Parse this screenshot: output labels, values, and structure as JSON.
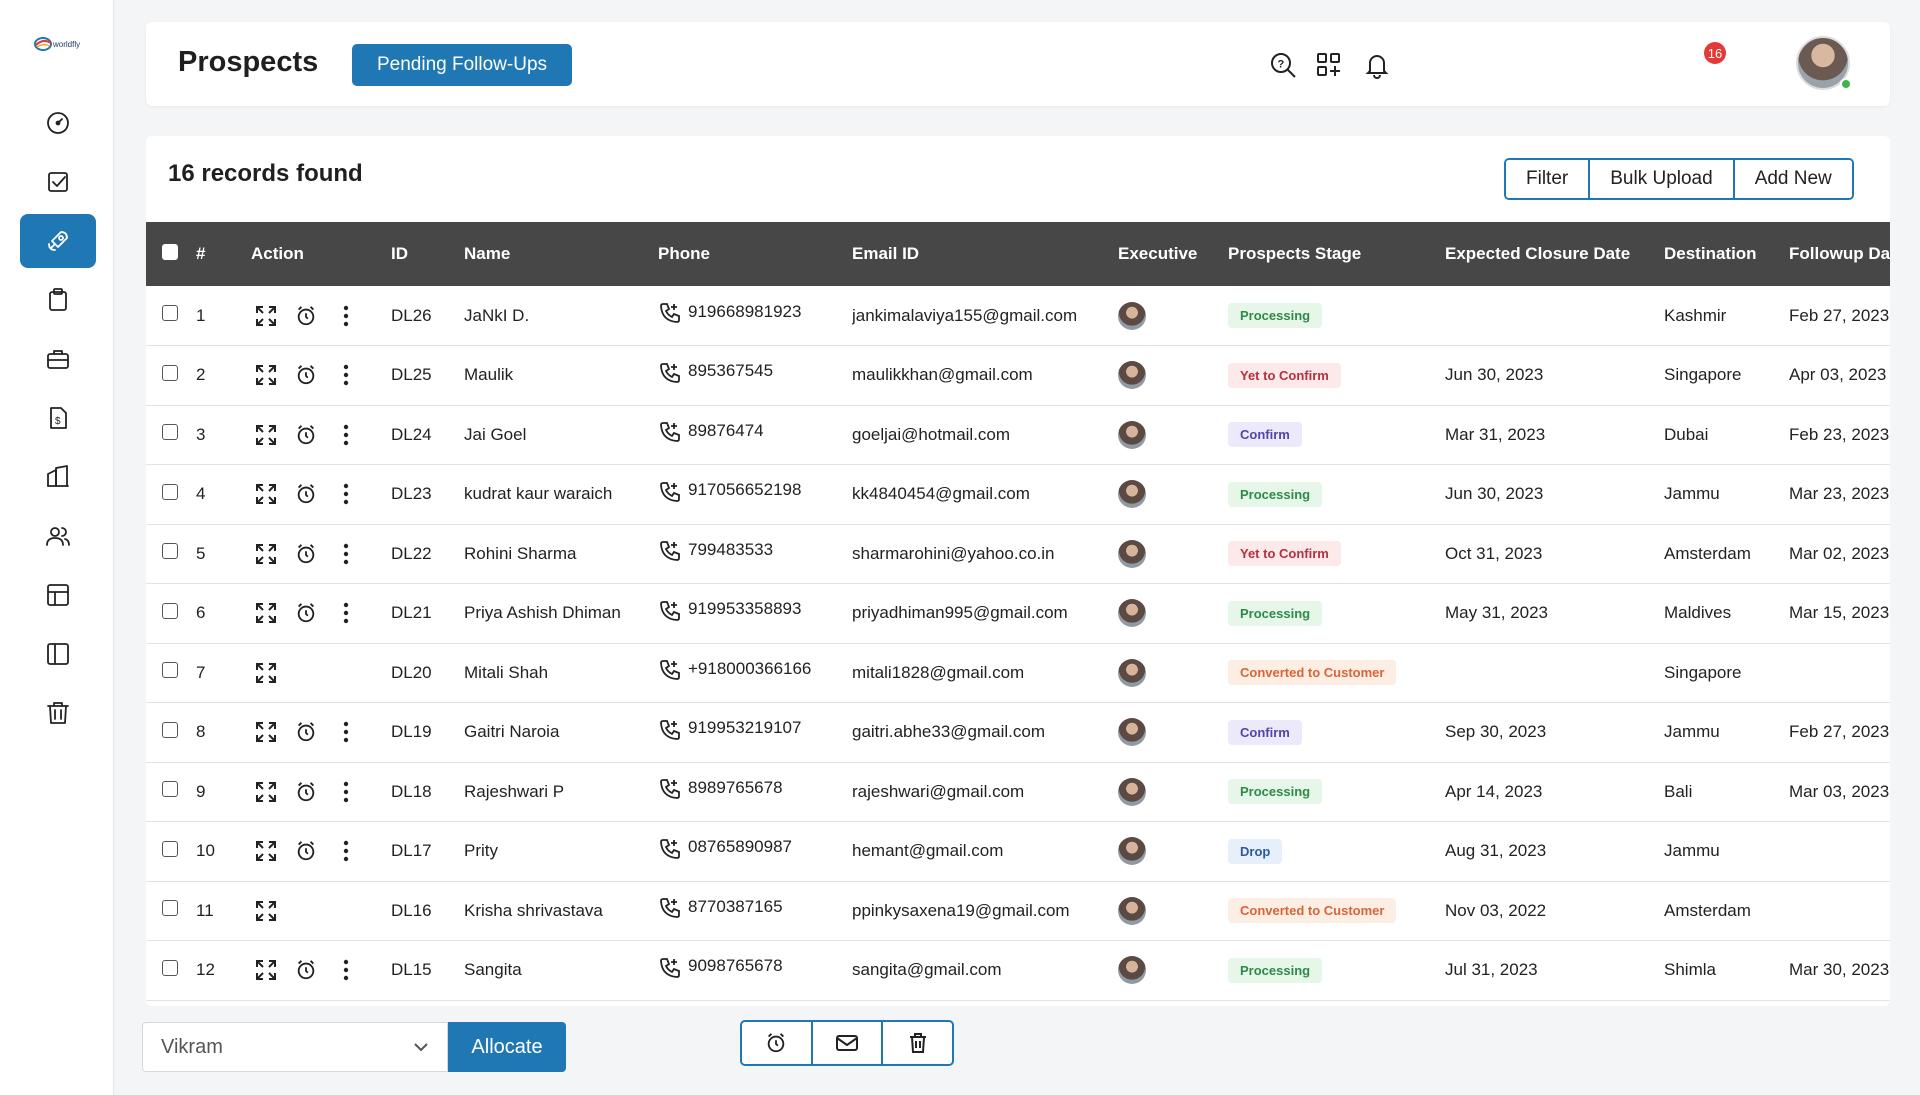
{
  "app": {
    "logo_text": "worldfly"
  },
  "sidebar": {
    "items": [
      {
        "icon": "gauge-icon"
      },
      {
        "icon": "checklist-icon"
      },
      {
        "icon": "rocket-icon",
        "active": true
      },
      {
        "icon": "clipboard-icon"
      },
      {
        "icon": "briefcase-icon"
      },
      {
        "icon": "invoice-icon"
      },
      {
        "icon": "buildings-icon"
      },
      {
        "icon": "users-icon"
      },
      {
        "icon": "table-icon"
      },
      {
        "icon": "panel-icon"
      },
      {
        "icon": "trash-icon"
      }
    ]
  },
  "header": {
    "title": "Prospects",
    "pending_label": "Pending Follow-Ups",
    "notification_count": "16"
  },
  "toolbar": {
    "records_text": "16 records found",
    "filter_label": "Filter",
    "bulk_upload_label": "Bulk Upload",
    "add_new_label": "Add New"
  },
  "table": {
    "headers": [
      "#",
      "Action",
      "ID",
      "Name",
      "Phone",
      "Email ID",
      "Executive",
      "Prospects Stage",
      "Expected Closure Date",
      "Destination",
      "Followup Da"
    ],
    "rows": [
      {
        "num": "1",
        "id": "DL26",
        "name": "JaNkI D.",
        "phone": "919668981923",
        "email": "jankimalaviya155@gmail.com",
        "stage": "Processing",
        "stage_type": "processing",
        "closure": "",
        "destination": "Kashmir",
        "followup": "Feb 27, 2023",
        "actions": "full"
      },
      {
        "num": "2",
        "id": "DL25",
        "name": "Maulik",
        "phone": "895367545",
        "email": "maulikkhan@gmail.com",
        "stage": "Yet to Confirm",
        "stage_type": "yet",
        "closure": "Jun 30, 2023",
        "destination": "Singapore",
        "followup": "Apr 03, 2023",
        "actions": "full"
      },
      {
        "num": "3",
        "id": "DL24",
        "name": "Jai Goel",
        "phone": "89876474",
        "email": "goeljai@hotmail.com",
        "stage": "Confirm",
        "stage_type": "confirm",
        "closure": "Mar 31, 2023",
        "destination": "Dubai",
        "followup": "Feb 23, 2023",
        "actions": "full"
      },
      {
        "num": "4",
        "id": "DL23",
        "name": "kudrat kaur waraich",
        "phone": "917056652198",
        "email": "kk4840454@gmail.com",
        "stage": "Processing",
        "stage_type": "processing",
        "closure": "Jun 30, 2023",
        "destination": "Jammu",
        "followup": "Mar 23, 2023",
        "actions": "full"
      },
      {
        "num": "5",
        "id": "DL22",
        "name": "Rohini Sharma",
        "phone": "799483533",
        "email": "sharmarohini@yahoo.co.in",
        "stage": "Yet to Confirm",
        "stage_type": "yet",
        "closure": "Oct 31, 2023",
        "destination": "Amsterdam",
        "followup": "Mar 02, 2023",
        "actions": "full"
      },
      {
        "num": "6",
        "id": "DL21",
        "name": "Priya Ashish Dhiman",
        "phone": "919953358893",
        "email": "priyadhiman995@gmail.com",
        "stage": "Processing",
        "stage_type": "processing",
        "closure": "May 31, 2023",
        "destination": "Maldives",
        "followup": "Mar 15, 2023",
        "actions": "full"
      },
      {
        "num": "7",
        "id": "DL20",
        "name": "Mitali Shah",
        "phone": "+918000366166",
        "email": "mitali1828@gmail.com",
        "stage": "Converted to Customer",
        "stage_type": "converted",
        "closure": "",
        "destination": "Singapore",
        "followup": "",
        "actions": "expand"
      },
      {
        "num": "8",
        "id": "DL19",
        "name": "Gaitri Naroia",
        "phone": "919953219107",
        "email": "gaitri.abhe33@gmail.com",
        "stage": "Confirm",
        "stage_type": "confirm",
        "closure": "Sep 30, 2023",
        "destination": "Jammu",
        "followup": "Feb 27, 2023",
        "actions": "full"
      },
      {
        "num": "9",
        "id": "DL18",
        "name": "Rajeshwari P",
        "phone": "8989765678",
        "email": "rajeshwari@gmail.com",
        "stage": "Processing",
        "stage_type": "processing",
        "closure": "Apr 14, 2023",
        "destination": "Bali",
        "followup": "Mar 03, 2023",
        "actions": "full"
      },
      {
        "num": "10",
        "id": "DL17",
        "name": "Prity",
        "phone": "08765890987",
        "email": "hemant@gmail.com",
        "stage": "Drop",
        "stage_type": "drop",
        "closure": "Aug 31, 2023",
        "destination": "Jammu",
        "followup": "",
        "actions": "full"
      },
      {
        "num": "11",
        "id": "DL16",
        "name": "Krisha shrivastava",
        "phone": "8770387165",
        "email": "ppinkysaxena19@gmail.com",
        "stage": "Converted to Customer",
        "stage_type": "converted",
        "closure": "Nov 03, 2022",
        "destination": "Amsterdam",
        "followup": "",
        "actions": "expand"
      },
      {
        "num": "12",
        "id": "DL15",
        "name": "Sangita",
        "phone": "9098765678",
        "email": "sangita@gmail.com",
        "stage": "Processing",
        "stage_type": "processing",
        "closure": "Jul 31, 2023",
        "destination": "Shimla",
        "followup": "Mar 30, 2023",
        "actions": "full"
      }
    ]
  },
  "footer": {
    "executive_value": "Vikram",
    "allocate_label": "Allocate"
  },
  "colors": {
    "accent": "#1f78b4",
    "header_bg": "#474747"
  }
}
